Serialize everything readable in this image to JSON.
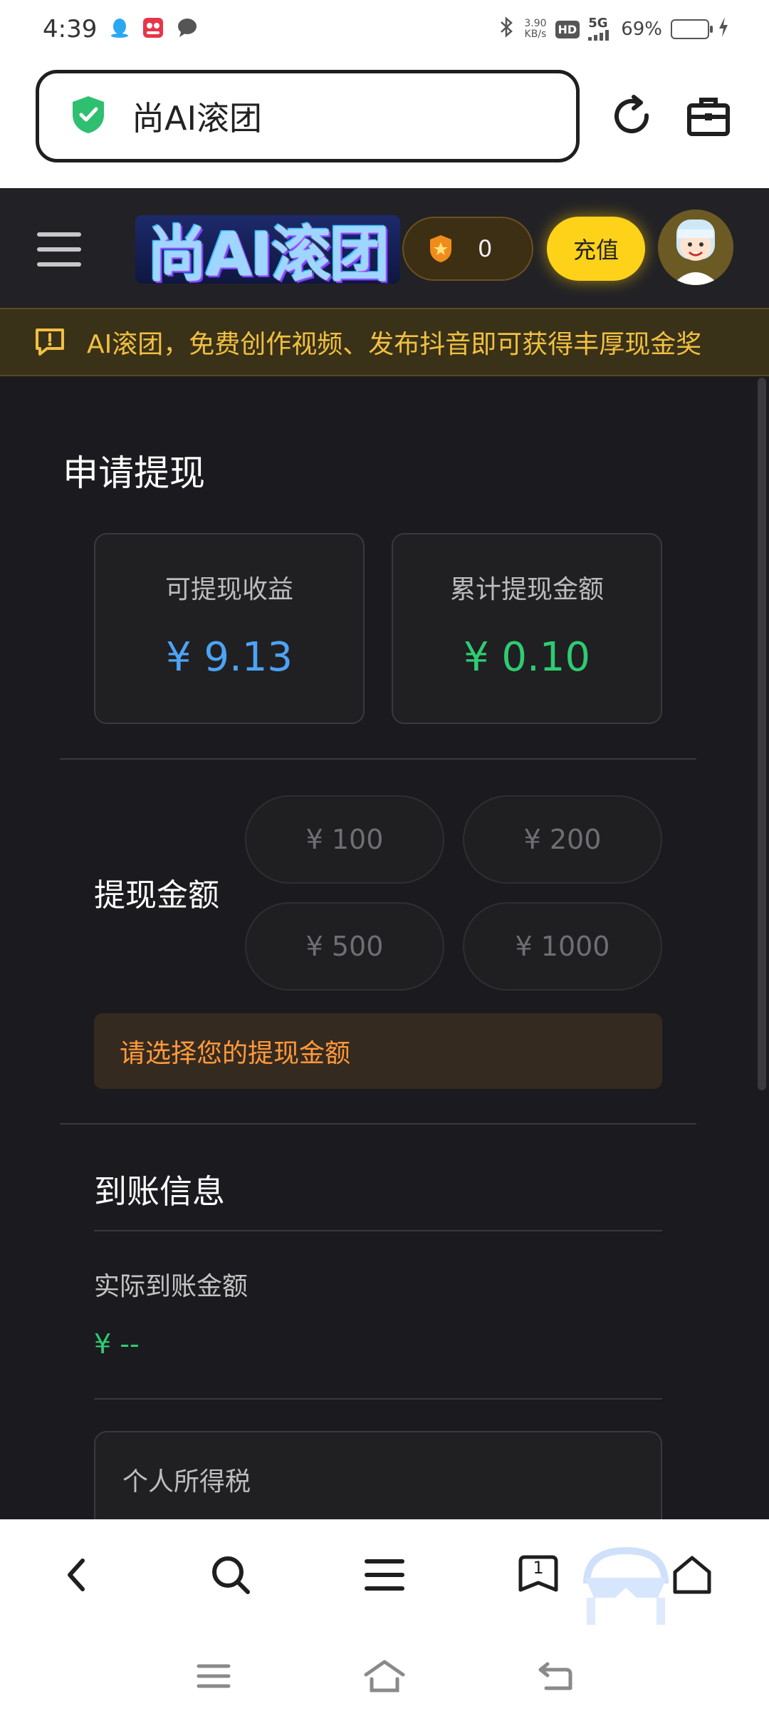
{
  "status_bar": {
    "time": "4:39",
    "net_speed_value": "3.90",
    "net_speed_unit": "KB/s",
    "hd_label": "HD",
    "network": "5G",
    "battery_percent": "69%",
    "battery_level": 0.69
  },
  "browser": {
    "url_title": "尚AI滚团"
  },
  "site_header": {
    "logo_text": "尚AI滚团",
    "coin_count": "0",
    "recharge_label": "充值"
  },
  "notice": {
    "text": "AI滚团，免费创作视频、发布抖音即可获得丰厚现金奖"
  },
  "withdraw": {
    "title": "申请提现",
    "cards": [
      {
        "label": "可提现收益",
        "value": "¥ 9.13",
        "color": "#4da3f5"
      },
      {
        "label": "累计提现金额",
        "value": "¥ 0.10",
        "color": "#2ecc71"
      }
    ],
    "amount_label": "提现金额",
    "amount_options": [
      "¥ 100",
      "¥ 200",
      "¥ 500",
      "¥ 1000"
    ],
    "hint": "请选择您的提现金额",
    "arrival_title": "到账信息",
    "actual_label": "实际到账金额",
    "actual_value": "¥ --",
    "tax_label": "个人所得税"
  },
  "bottom_nav": {
    "tab_count": "1"
  }
}
